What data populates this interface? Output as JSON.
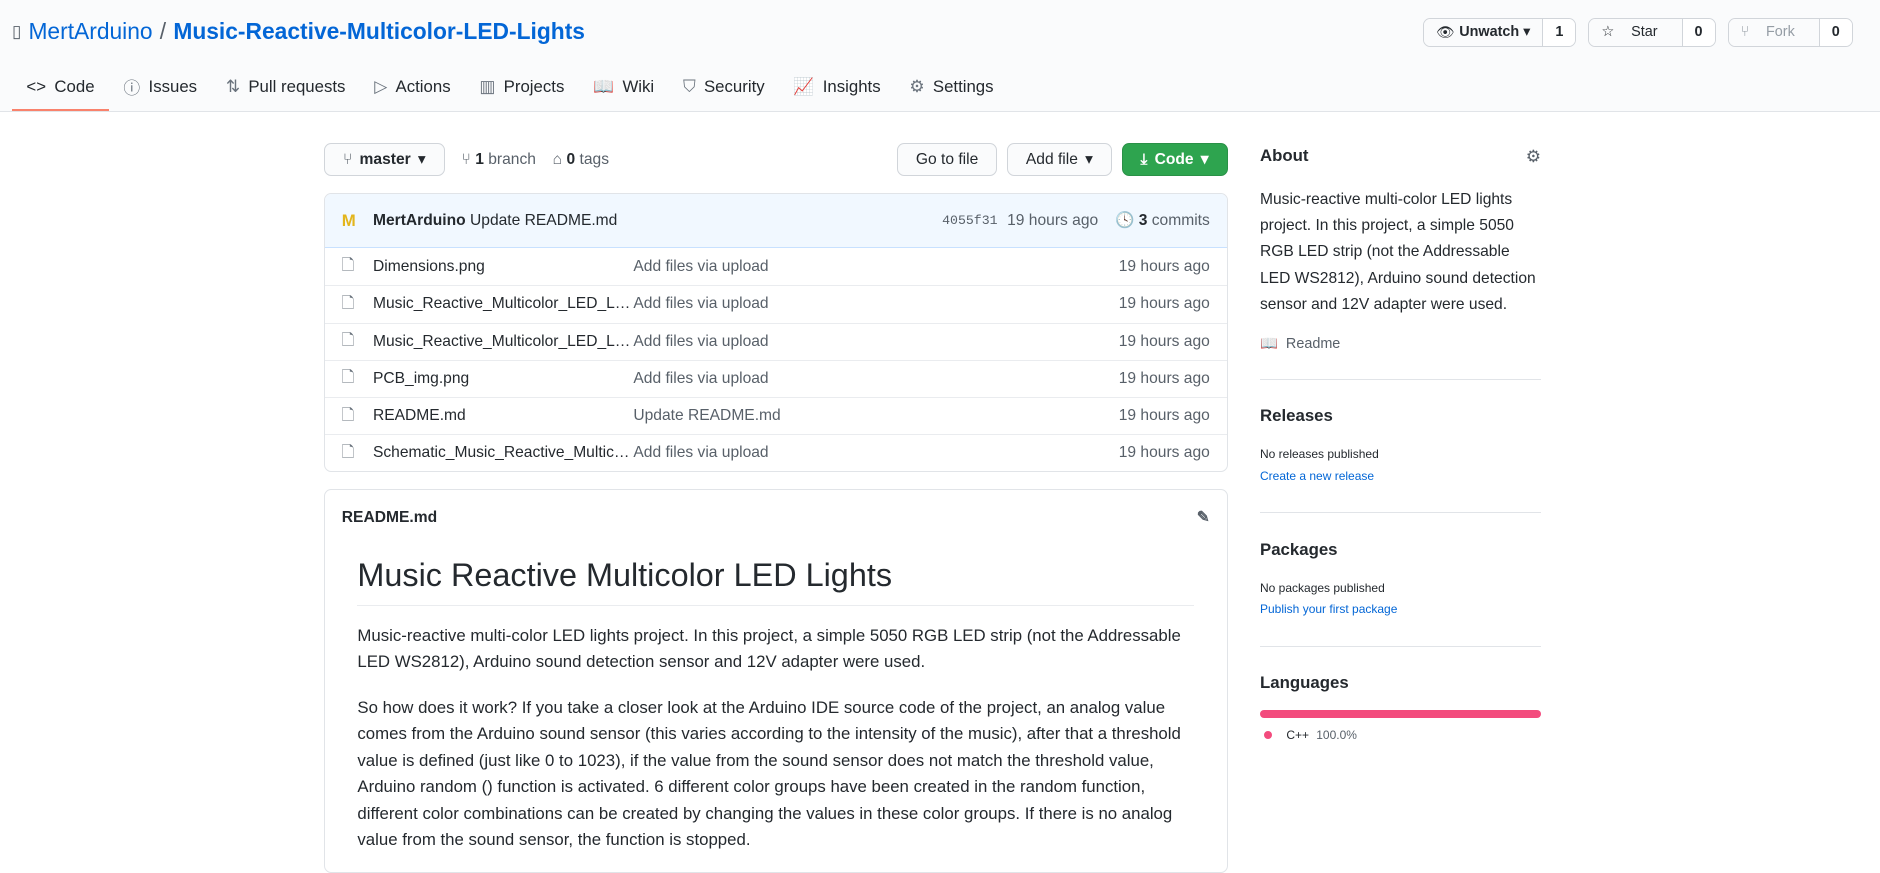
{
  "header": {
    "owner": "MertArduino",
    "separator": "/",
    "repo": "Music-Reactive-Multicolor-LED-Lights",
    "watch": {
      "label": "Unwatch",
      "count": "1"
    },
    "star": {
      "label": "Star",
      "count": "0"
    },
    "fork": {
      "label": "Fork",
      "count": "0"
    }
  },
  "tabs": [
    {
      "label": "Code",
      "icon": "code-icon"
    },
    {
      "label": "Issues",
      "icon": "issue-icon"
    },
    {
      "label": "Pull requests",
      "icon": "pull-request-icon"
    },
    {
      "label": "Actions",
      "icon": "play-icon"
    },
    {
      "label": "Projects",
      "icon": "project-icon"
    },
    {
      "label": "Wiki",
      "icon": "book-icon"
    },
    {
      "label": "Security",
      "icon": "shield-icon"
    },
    {
      "label": "Insights",
      "icon": "graph-icon"
    },
    {
      "label": "Settings",
      "icon": "gear-icon"
    }
  ],
  "toolbar": {
    "branch": "master",
    "branch_count": "1",
    "branch_label": "branch",
    "tag_count": "0",
    "tag_label": "tags",
    "go_to_file": "Go to file",
    "add_file": "Add file",
    "code": "Code"
  },
  "commit": {
    "author": "MertArduino",
    "message": "Update README.md",
    "sha": "4055f31",
    "time": "19 hours ago",
    "count": "3",
    "count_label": "commits"
  },
  "files": [
    {
      "name": "Dimensions.png",
      "message": "Add files via upload",
      "time": "19 hours ago"
    },
    {
      "name": "Music_Reactive_Multicolor_LED_Light...",
      "message": "Add files via upload",
      "time": "19 hours ago"
    },
    {
      "name": "Music_Reactive_Multicolor_LED_Light...",
      "message": "Add files via upload",
      "time": "19 hours ago"
    },
    {
      "name": "PCB_img.png",
      "message": "Add files via upload",
      "time": "19 hours ago"
    },
    {
      "name": "README.md",
      "message": "Update README.md",
      "time": "19 hours ago"
    },
    {
      "name": "Schematic_Music_Reactive_Multicolor...",
      "message": "Add files via upload",
      "time": "19 hours ago"
    }
  ],
  "readme": {
    "filename": "README.md",
    "title": "Music Reactive Multicolor LED Lights",
    "p1": "Music-reactive multi-color LED lights project. In this project, a simple 5050 RGB LED strip (not the Addressable LED WS2812), Arduino sound detection sensor and 12V adapter were used.",
    "p2": "So how does it work? If you take a closer look at the Arduino IDE source code of the project, an analog value comes from the Arduino sound sensor (this varies according to the intensity of the music), after that a threshold value is defined (just like 0 to 1023), if the value from the sound sensor does not match the threshold value, Arduino random () function is activated. 6 different color groups have been created in the random function, different color combinations can be created by changing the values in these color groups. If there is no analog value from the sound sensor, the function is stopped."
  },
  "sidebar": {
    "about_title": "About",
    "about": "Music-reactive multi-color LED lights project. In this project, a simple 5050 RGB LED strip (not the Addressable LED WS2812), Arduino sound detection sensor and 12V adapter were used.",
    "readme_link": "Readme",
    "releases_title": "Releases",
    "releases_none": "No releases published",
    "releases_link": "Create a new release",
    "packages_title": "Packages",
    "packages_none": "No packages published",
    "packages_link": "Publish your first package",
    "languages_title": "Languages",
    "languages": [
      {
        "name": "C++",
        "percent": "100.0%",
        "value": 100,
        "color": "#f34b7d"
      }
    ]
  }
}
